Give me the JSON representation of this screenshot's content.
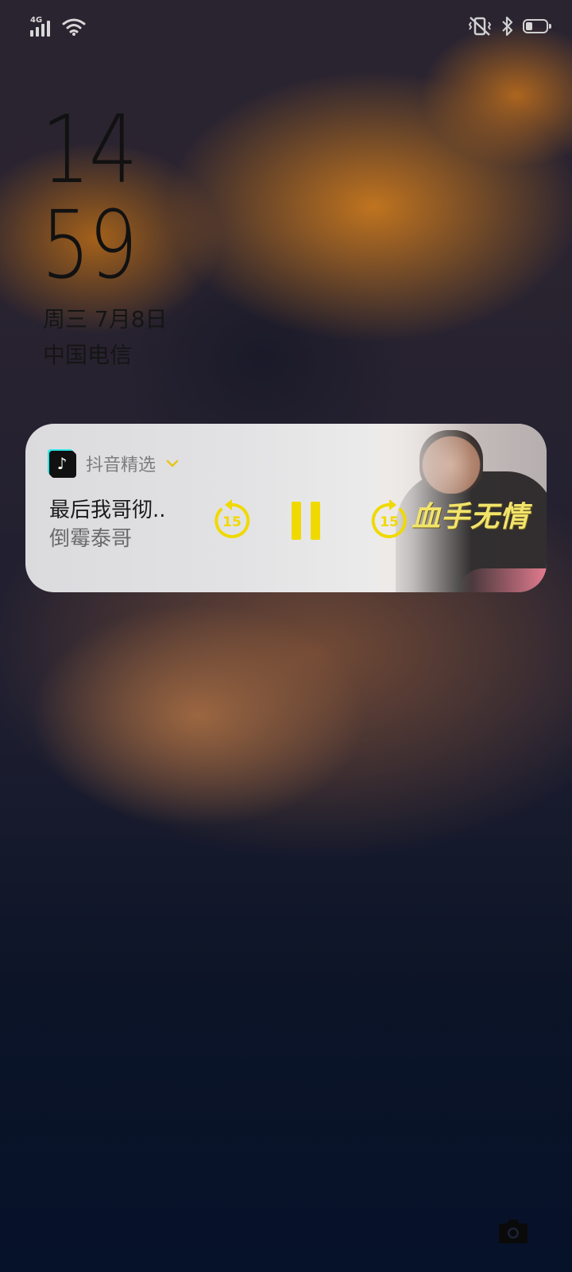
{
  "status_bar": {
    "network": "4G",
    "icons": [
      "signal-icon",
      "wifi-icon",
      "vibrate-icon",
      "bluetooth-icon",
      "battery-icon"
    ],
    "battery_level": 0.35
  },
  "lockscreen": {
    "hour": "14",
    "minute": "59",
    "date": "周三  7月8日",
    "carrier": "中国电信"
  },
  "media": {
    "app_name": "抖音精选",
    "title": "最后我哥彻..",
    "artist": "倒霉泰哥",
    "overlay_text": "血手无情",
    "rewind_seconds": "15",
    "forward_seconds": "15",
    "state": "playing",
    "accent_color": "#f0d900"
  },
  "shortcut": {
    "icon": "camera-icon"
  }
}
